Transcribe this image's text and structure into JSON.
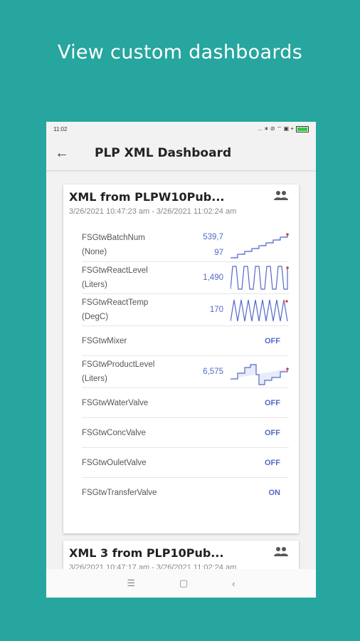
{
  "promo": {
    "title": "View custom dashboards"
  },
  "statusbar": {
    "time": "11:02",
    "icons": "... ∗ ⊘ ⌔ ▣ +"
  },
  "appbar": {
    "title": "PLP XML Dashboard"
  },
  "cards": [
    {
      "title": "XML from PLPW10Pub...",
      "range": "3/26/2021 10:47:23 am - 3/26/2021 11:02:24 am",
      "rows": [
        {
          "name": "FSGtwBatchNum",
          "unit": "(None)",
          "value_line1": "539,7",
          "value_line2": "97",
          "chart": "step-up"
        },
        {
          "name": "FSGtwReactLevel",
          "unit": "(Liters)",
          "value_line1": "1,490",
          "chart": "wave-dense"
        },
        {
          "name": "FSGtwReactTemp",
          "unit": "(DegC)",
          "value_line1": "170",
          "chart": "wave"
        },
        {
          "name": "FSGtwMixer",
          "state": "OFF"
        },
        {
          "name": "FSGtwProductLevel",
          "unit": "(Liters)",
          "value_line1": "6,575",
          "chart": "step-mixed"
        },
        {
          "name": "FSGtwWaterValve",
          "state": "OFF"
        },
        {
          "name": "FSGtwConcValve",
          "state": "OFF"
        },
        {
          "name": "FSGtwOuletValve",
          "state": "OFF"
        },
        {
          "name": "FSGtwTransferValve",
          "state": "ON"
        }
      ]
    },
    {
      "title": "XML 3 from PLP10Pub...",
      "range": "3/26/2021 10:47:17 am - 3/26/2021 11:02:24 am"
    }
  ],
  "colors": {
    "background": "#26a69e",
    "accent": "#5469c9",
    "marker": "#e53935"
  },
  "icons": {
    "back": "arrow-back-icon",
    "people": "group-icon",
    "nav": [
      "menu-icon",
      "home-square-icon",
      "back-chevron-icon"
    ]
  }
}
